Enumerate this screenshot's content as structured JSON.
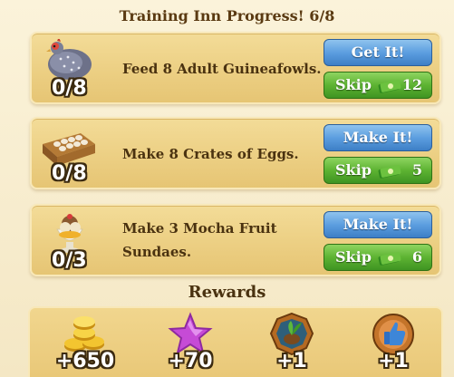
{
  "header": {
    "title": "Training Inn Progress! 6/8"
  },
  "tasks": [
    {
      "icon": "guineafowl-icon",
      "count": "0/8",
      "text": "Feed 8 Adult Guineafowls.",
      "action_label": "Get It!",
      "skip_label": "Skip",
      "skip_cost": "12"
    },
    {
      "icon": "egg-crate-icon",
      "count": "0/8",
      "text": "Make 8 Crates of Eggs.",
      "action_label": "Make It!",
      "skip_label": "Skip",
      "skip_cost": "5"
    },
    {
      "icon": "sundae-icon",
      "count": "0/3",
      "text": "Make 3 Mocha Fruit Sundaes.",
      "action_label": "Make It!",
      "skip_label": "Skip",
      "skip_cost": "6"
    }
  ],
  "rewards": {
    "label": "Rewards",
    "items": [
      {
        "icon": "coins-icon",
        "value": "+650"
      },
      {
        "icon": "star-icon",
        "value": "+70"
      },
      {
        "icon": "seed-token-icon",
        "value": "+1"
      },
      {
        "icon": "thumbs-up-token-icon",
        "value": "+1"
      }
    ]
  },
  "colors": {
    "action_blue": "#5c9ee0",
    "skip_green": "#5db332",
    "panel_gold": "#eccf83",
    "text_brown": "#4a3210"
  }
}
